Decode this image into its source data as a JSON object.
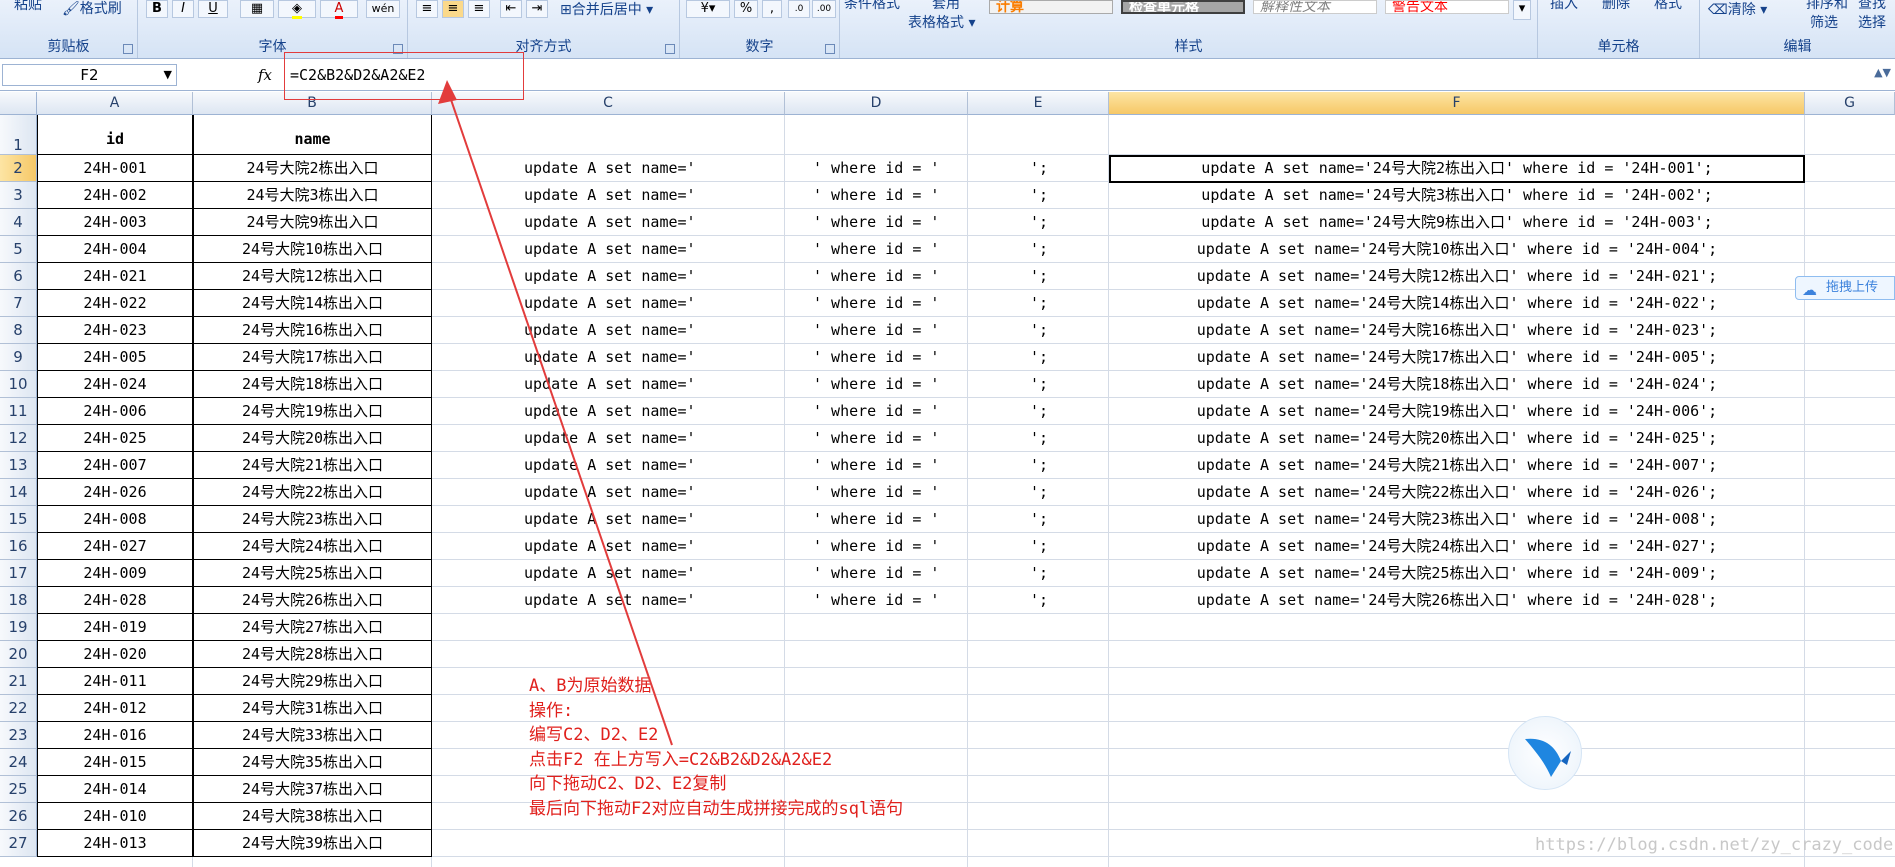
{
  "ribbon": {
    "clipboard": {
      "label": "剪贴板",
      "paste": "粘贴",
      "format_painter": "格式刷"
    },
    "font": {
      "label": "字体",
      "bold": "B",
      "italic": "I",
      "underline": "U",
      "phonetic": "wén"
    },
    "alignment": {
      "label": "对齐方式",
      "merge_center": "合并后居中"
    },
    "number": {
      "label": "数字",
      "percent": "%",
      "comma": ",",
      "inc_decimal": ".0",
      "dec_decimal": ".00"
    },
    "styles": {
      "label": "样式",
      "conditional": "条件格式",
      "table_format_1": "套用",
      "table_format_2": "表格格式",
      "style_calc": "计算",
      "style_check": "检查单元格",
      "style_explain": "解释性文本",
      "style_warning": "警告文本"
    },
    "cells": {
      "label": "单元格",
      "insert": "插入",
      "delete": "删除",
      "format": "格式"
    },
    "editing": {
      "label": "编辑",
      "clear": "清除",
      "sort_filter_1": "排序和",
      "sort_filter_2": "筛选",
      "find_1": "查找",
      "find_2": "选择"
    }
  },
  "formula_bar": {
    "name_box": "F2",
    "fx": "fx",
    "formula": "=C2&B2&D2&A2&E2"
  },
  "columns": [
    "A",
    "B",
    "C",
    "D",
    "E",
    "F",
    "G"
  ],
  "rows": [
    "1",
    "2",
    "3",
    "4",
    "5",
    "6",
    "7",
    "8",
    "9",
    "10",
    "11",
    "12",
    "13",
    "14",
    "15",
    "16",
    "17",
    "18",
    "19",
    "20",
    "21",
    "22",
    "23",
    "24",
    "25",
    "26",
    "27"
  ],
  "header": {
    "id": "id",
    "name": "name"
  },
  "data": {
    "ids": [
      "24H-001",
      "24H-002",
      "24H-003",
      "24H-004",
      "24H-021",
      "24H-022",
      "24H-023",
      "24H-005",
      "24H-024",
      "24H-006",
      "24H-025",
      "24H-007",
      "24H-026",
      "24H-008",
      "24H-027",
      "24H-009",
      "24H-028",
      "24H-019",
      "24H-020",
      "24H-011",
      "24H-012",
      "24H-016",
      "24H-015",
      "24H-014",
      "24H-010",
      "24H-013"
    ],
    "names": [
      "24号大院2栋出入口",
      "24号大院3栋出入口",
      "24号大院9栋出入口",
      "24号大院10栋出入口",
      "24号大院12栋出入口",
      "24号大院14栋出入口",
      "24号大院16栋出入口",
      "24号大院17栋出入口",
      "24号大院18栋出入口",
      "24号大院19栋出入口",
      "24号大院20栋出入口",
      "24号大院21栋出入口",
      "24号大院22栋出入口",
      "24号大院23栋出入口",
      "24号大院24栋出入口",
      "24号大院25栋出入口",
      "24号大院26栋出入口",
      "24号大院27栋出入口",
      "24号大院28栋出入口",
      "24号大院29栋出入口",
      "24号大院31栋出入口",
      "24号大院33栋出入口",
      "24号大院35栋出入口",
      "24号大院37栋出入口",
      "24号大院38栋出入口",
      "24号大院39栋出入口"
    ],
    "c_text": "update A set name='",
    "d_text": "' where id = '",
    "e_text": "';",
    "f_values": [
      "update A set name='24号大院2栋出入口' where id = '24H-001';",
      "update A set name='24号大院3栋出入口' where id = '24H-002';",
      "update A set name='24号大院9栋出入口' where id = '24H-003';",
      "update A set name='24号大院10栋出入口' where id = '24H-004';",
      "update A set name='24号大院12栋出入口' where id = '24H-021';",
      "update A set name='24号大院14栋出入口' where id = '24H-022';",
      "update A set name='24号大院16栋出入口' where id = '24H-023';",
      "update A set name='24号大院17栋出入口' where id = '24H-005';",
      "update A set name='24号大院18栋出入口' where id = '24H-024';",
      "update A set name='24号大院19栋出入口' where id = '24H-006';",
      "update A set name='24号大院20栋出入口' where id = '24H-025';",
      "update A set name='24号大院21栋出入口' where id = '24H-007';",
      "update A set name='24号大院22栋出入口' where id = '24H-026';",
      "update A set name='24号大院23栋出入口' where id = '24H-008';",
      "update A set name='24号大院24栋出入口' where id = '24H-027';",
      "update A set name='24号大院25栋出入口' where id = '24H-009';",
      "update A set name='24号大院26栋出入口' where id = '24H-028';"
    ]
  },
  "notes": [
    "A、B为原始数据",
    "操作:",
    "编写C2、D2、E2",
    "点击F2 在上方写入=C2&B2&D2&A2&E2",
    "向下拖动C2、D2、E2复制",
    "最后向下拖动F2对应自动生成拼接完成的sql语句"
  ],
  "upload_widget": "拖拽上传",
  "watermark": "https://blog.csdn.net/zy_crazy_code",
  "colors": {
    "annotation_red": "#e0201c",
    "selected_header": "#f6c867",
    "ribbon_text": "#15428b"
  }
}
